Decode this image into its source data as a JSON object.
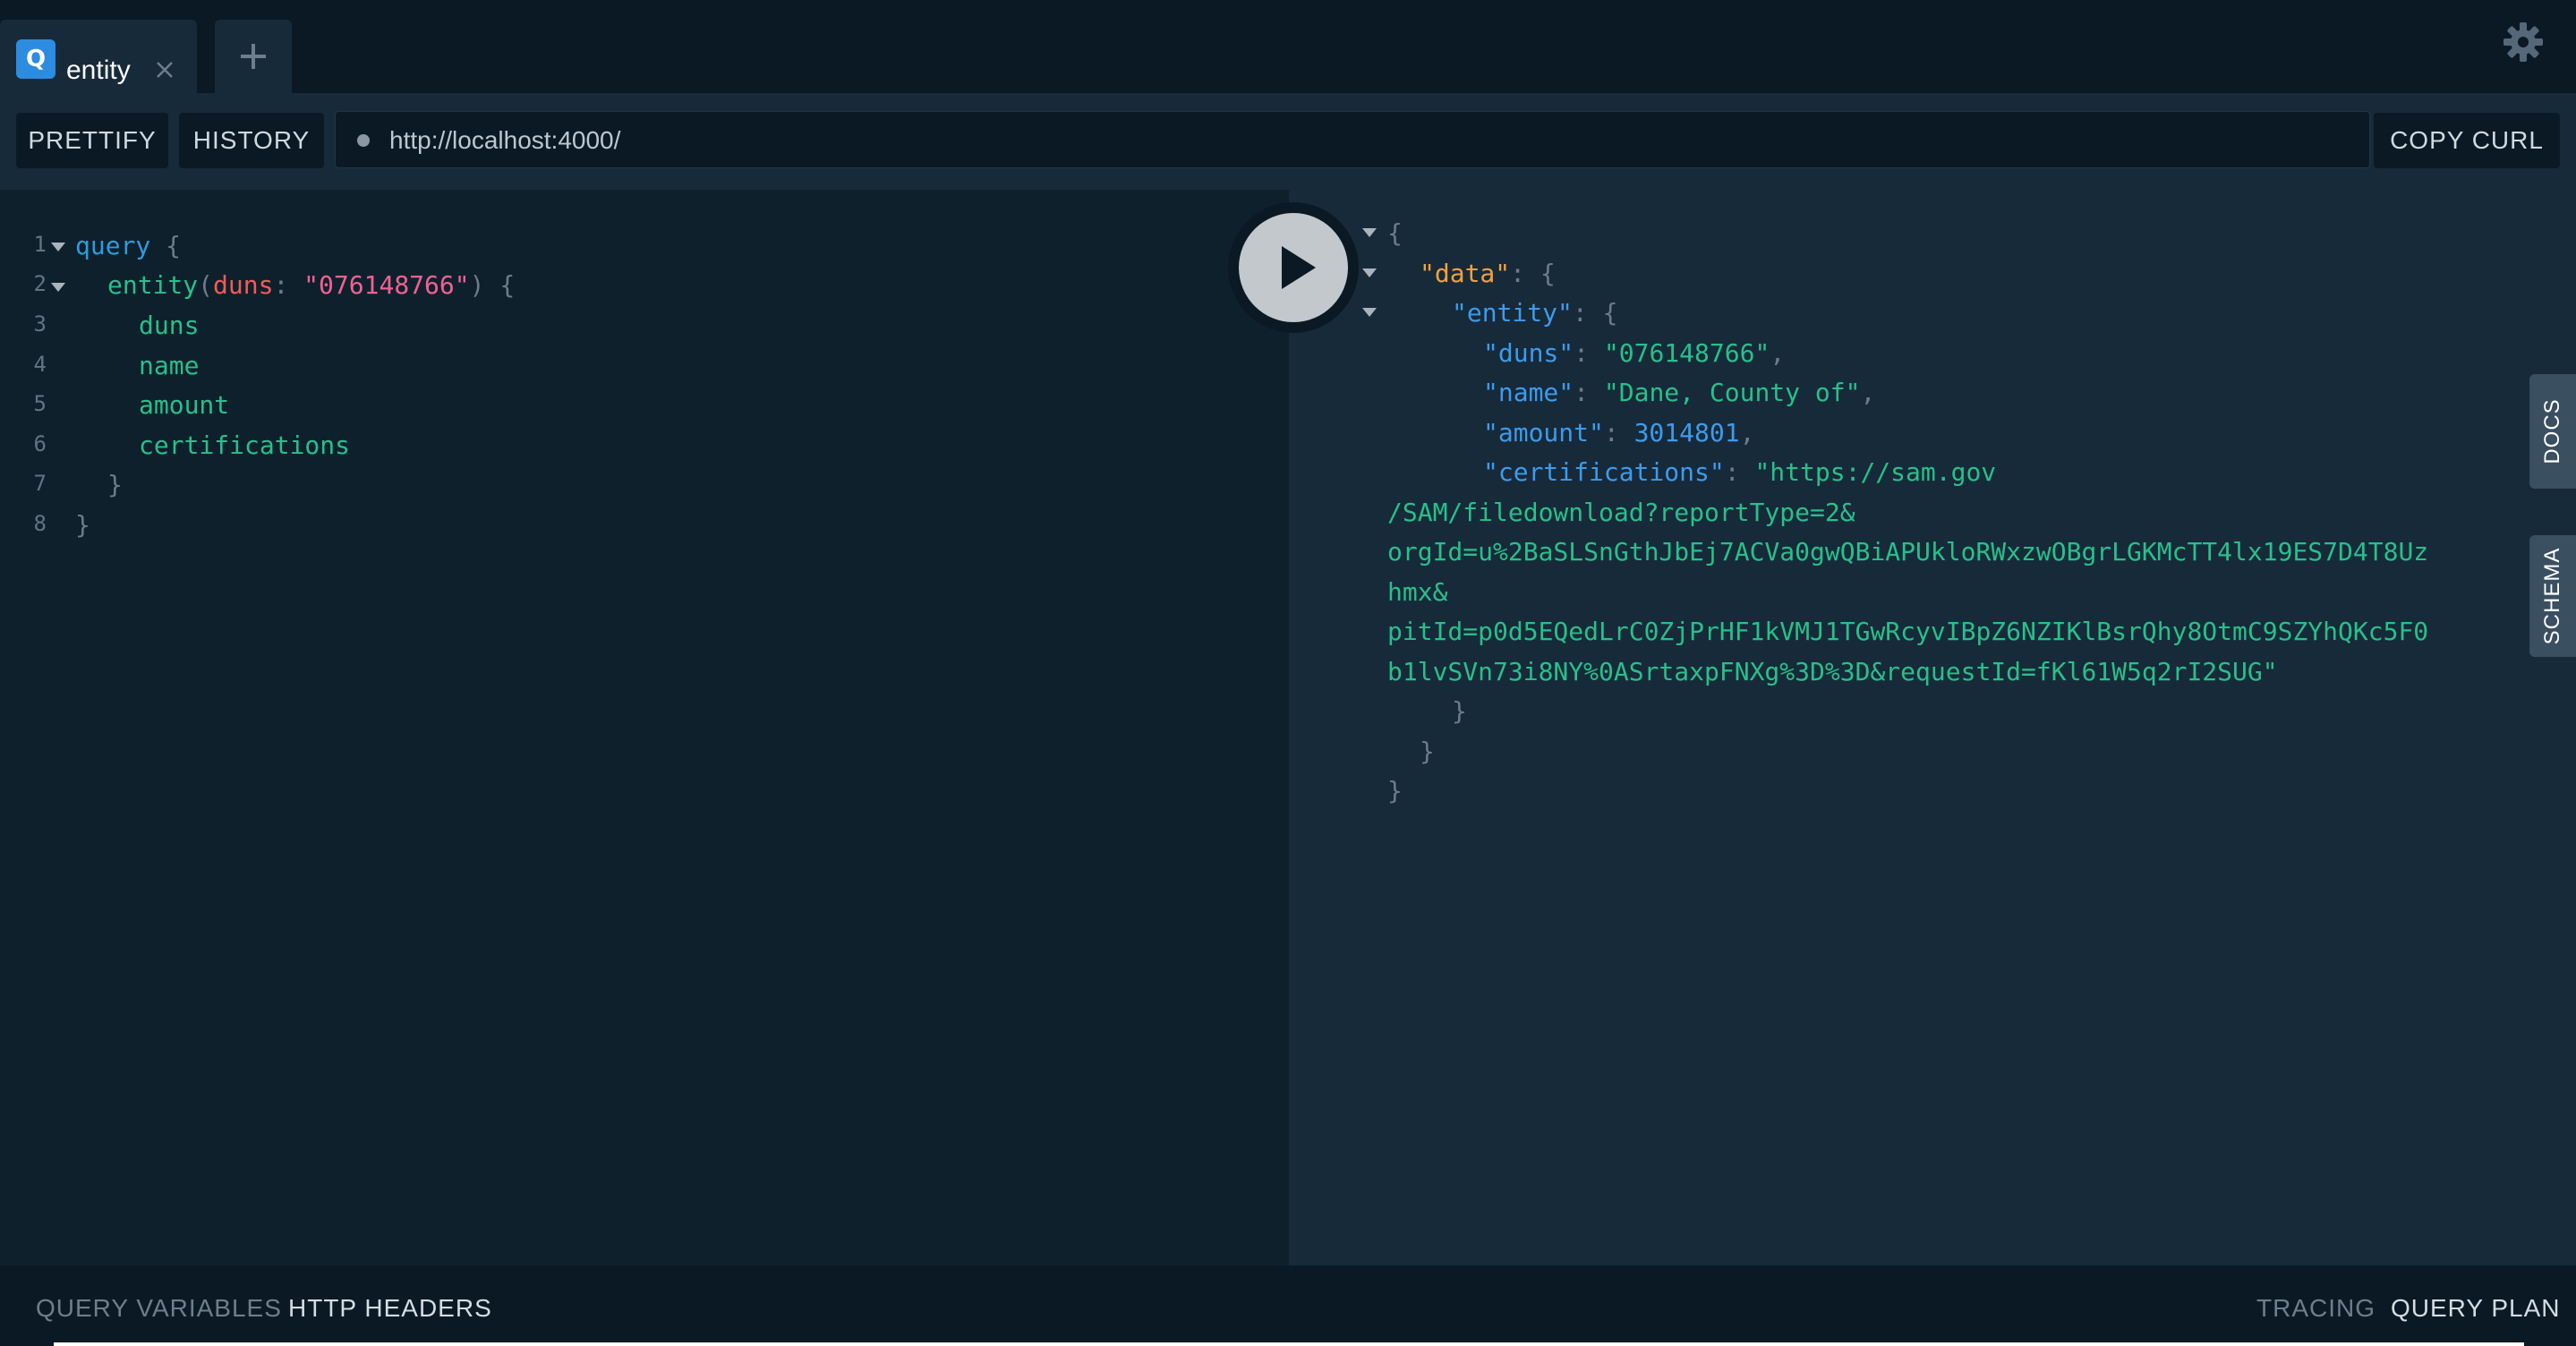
{
  "tab": {
    "badge": "Q",
    "title": "entity",
    "close_icon": "close-icon",
    "add_icon": "plus-icon"
  },
  "settings_icon": "gear-icon",
  "toolbar": {
    "prettify_label": "PRETTIFY",
    "history_label": "HISTORY",
    "url": "http://localhost:4000/",
    "copy_curl_label": "COPY CURL"
  },
  "editor": {
    "line_numbers": [
      "1",
      "2",
      "3",
      "4",
      "5",
      "6",
      "7",
      "8"
    ],
    "query_keyword": "query",
    "open_brace": "{",
    "close_brace": "}",
    "field_entity": "entity",
    "paren_open": "(",
    "arg_name": "duns",
    "colon": ":",
    "arg_value": "\"076148766\"",
    "paren_close": ")",
    "fields": [
      "duns",
      "name",
      "amount",
      "certifications"
    ]
  },
  "run_button_icon": "play-icon",
  "result": {
    "open": "{",
    "data_key": "\"data\"",
    "entity_key": "\"entity\"",
    "colon": ": ",
    "comma": ",",
    "duns_key": "\"duns\"",
    "duns_value": "\"076148766\"",
    "name_key": "\"name\"",
    "name_value": "\"Dane, County of\"",
    "amount_key": "\"amount\"",
    "amount_value": "3014801",
    "certifications_key": "\"certifications\"",
    "certifications_lines": [
      "\"https://sam.gov",
      "/SAM/filedownload?reportType=2&",
      "orgId=u%2BaSLSnGthJbEj7ACVa0gwQBiAPUkloRWxzwOBgrLGKMcTT4lx19ES7D4T8Uz",
      "hmx&",
      "pitId=p0d5EQedLrC0ZjPrHF1kVMJ1TGwRcyvIBpZ6NZIKlBsrQhy8OtmC9SZYhQKc5F0",
      "b1lvSVn73i8NY%0ASrtaxpFNXg%3D%3D&requestId=fKl61W5q2rI2SUG\""
    ],
    "close": "}"
  },
  "side_tabs": {
    "docs": "DOCS",
    "schema": "SCHEMA"
  },
  "bottom": {
    "query_variables": "QUERY VARIABLES",
    "http_headers": "HTTP HEADERS",
    "tracing": "TRACING",
    "query_plan": "QUERY PLAN"
  },
  "colors": {
    "background": "#0f202d",
    "result_background": "#172a3a",
    "keyword": "#2d9cdb",
    "field": "#27c08a",
    "string": "#f06292",
    "data_key": "#f3a03f"
  }
}
